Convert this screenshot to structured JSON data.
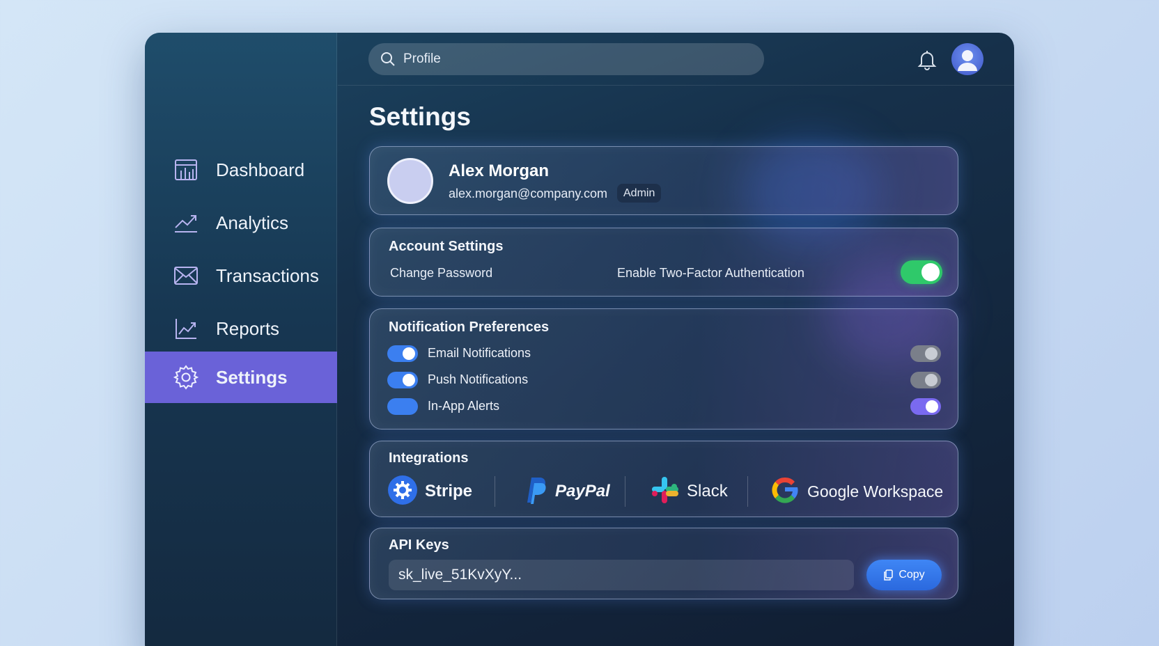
{
  "search": {
    "value": "Profile",
    "icon": "search-icon"
  },
  "header": {
    "notification_icon": "bell-icon",
    "avatar_icon": "user-avatar-icon"
  },
  "sidebar": {
    "items": [
      {
        "label": "Dashboard",
        "icon": "dashboard-icon",
        "active": false
      },
      {
        "label": "Analytics",
        "icon": "analytics-trend-icon",
        "active": false
      },
      {
        "label": "Transactions",
        "icon": "envelope-icon",
        "active": false
      },
      {
        "label": "Reports",
        "icon": "line-chart-icon",
        "active": false
      },
      {
        "label": "Settings",
        "icon": "gear-icon",
        "active": true
      }
    ],
    "active_color": "#6a62d8"
  },
  "page": {
    "title": "Settings"
  },
  "profile": {
    "name": "Alex Morgan",
    "email": "alex.morgan@company.com",
    "role_badge": "Admin"
  },
  "account_settings": {
    "title": "Account Settings",
    "change_password_label": "Change Password",
    "two_factor_label": "Enable Two-Factor Authentication",
    "two_factor_enabled": true,
    "toggle_on_color": "#2fc96a"
  },
  "notification_preferences": {
    "title": "Notification Preferences",
    "items": [
      {
        "label": "Email Notifications",
        "left_toggle": true,
        "right_toggle": false
      },
      {
        "label": "Push Notifications",
        "left_toggle": true,
        "right_toggle": false
      },
      {
        "label": "In-App Alerts",
        "left_toggle": true,
        "right_toggle": true
      }
    ],
    "toggle_on_color": "#3b7ff0",
    "toggle_alt_color": "#7a6af0"
  },
  "integrations": {
    "title": "Integrations",
    "items": [
      {
        "name": "Stripe",
        "icon": "stripe-logo-icon"
      },
      {
        "name": "PayPal",
        "icon": "paypal-logo-icon"
      },
      {
        "name": "Slack",
        "icon": "slack-logo-icon"
      },
      {
        "name": "Google Workspace",
        "icon": "google-logo-icon"
      }
    ]
  },
  "api_keys": {
    "title": "API Keys",
    "key_value": "sk_live_51KvXyY...",
    "copy_label": "Copy",
    "copy_icon": "copy-icon"
  }
}
